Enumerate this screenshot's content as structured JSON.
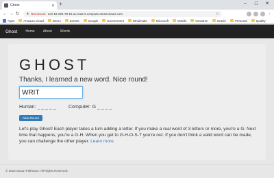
{
  "browser": {
    "tab_title": "Ghost",
    "new_tab": "+",
    "url_warning": "Not secure",
    "url": "ec2-18-224-78-15.us-east-2.compute.amazonaws.com",
    "bookmarks": [
      "Apps",
      "Amazon Cloud",
      "Demo",
      "Events",
      "Google",
      "Government",
      "Wholesale",
      "Microsoft",
      "Mobile",
      "Novatron",
      "Oracle",
      "Personal",
      "Quality"
    ]
  },
  "nav": {
    "brand": "Ghost",
    "links": [
      "Home",
      "About",
      "Words"
    ]
  },
  "game": {
    "title": "GHOST",
    "message": "Thanks, I learned a new word. Nice round!",
    "current_word": "WRIT",
    "human_score": "Human: _ _ _ _ _",
    "computer_score": "Computer: G _ _ _ _",
    "new_round_label": "New Round",
    "rules_text": "Let's play Ghost! Each player takes a turn adding a letter. If you make a real word of 3 letters or more, you're a G. Next time that happens, you're a G-H. When you get to G-H-O-S-T you're out. If you don't think a valid word can be made, you can challenge the other player.",
    "learn_more": "Learn more"
  },
  "footer": {
    "text": "© 2018 Susan Pallmann. All Rights Reserved."
  }
}
